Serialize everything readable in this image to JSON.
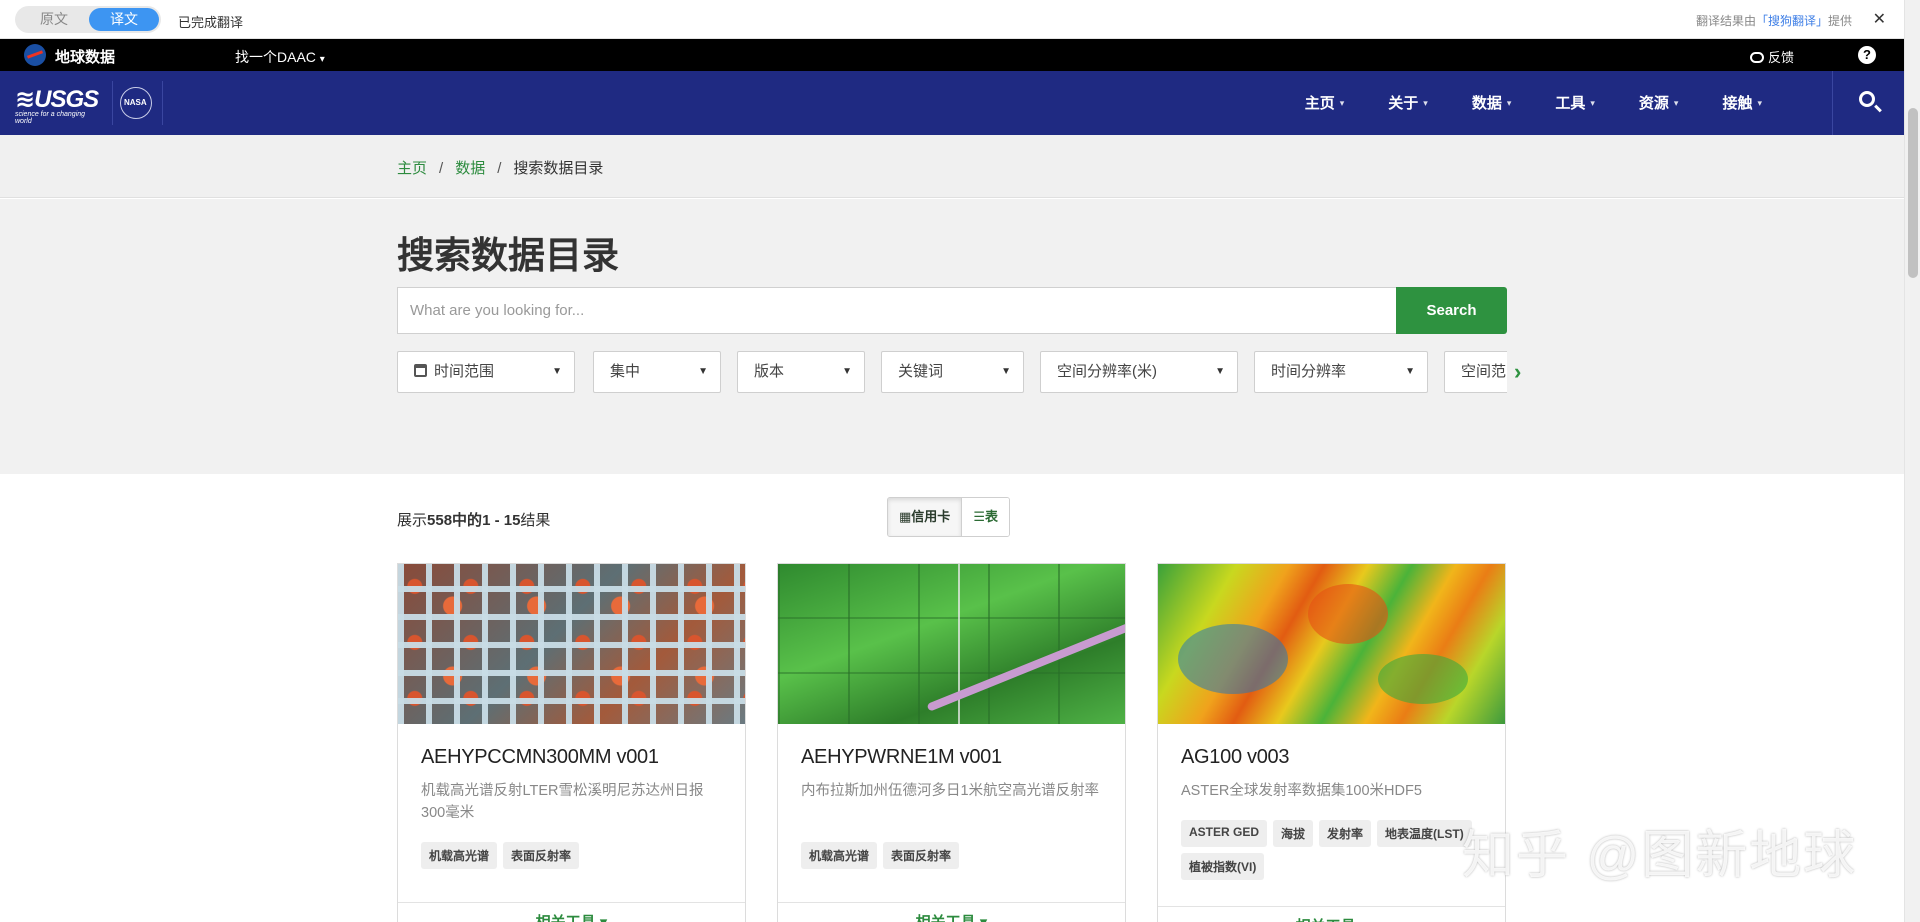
{
  "translate_bar": {
    "original_label": "原文",
    "translated_label": "译文",
    "status": "已完成翻译",
    "provider_prefix": "翻译结果由",
    "provider_link": "「搜狗翻译」",
    "provider_suffix": "提供",
    "close": "✕"
  },
  "topbar": {
    "site_title": "地球数据",
    "daac_label": "找一个DAAC",
    "daac_caret": "▾",
    "feedback": "反馈",
    "help": "?"
  },
  "nav": {
    "usgs_text": "≋USGS",
    "usgs_tagline": "science for a changing world",
    "nasa_text": "NASA",
    "items": [
      {
        "label": "主页"
      },
      {
        "label": "关于"
      },
      {
        "label": "数据"
      },
      {
        "label": "工具"
      },
      {
        "label": "资源"
      },
      {
        "label": "接触"
      }
    ],
    "caret": "▾"
  },
  "breadcrumb": {
    "items": [
      "主页",
      "数据",
      "搜索数据目录"
    ],
    "separator": "/"
  },
  "search": {
    "title": "搜索数据目录",
    "placeholder": "What are you looking for...",
    "value": "",
    "button": "Search"
  },
  "filters": [
    {
      "label": "时间范围"
    },
    {
      "label": "集中"
    },
    {
      "label": "版本"
    },
    {
      "label": "关键词"
    },
    {
      "label": "空间分辨率(米)"
    },
    {
      "label": "时间分辨率"
    },
    {
      "label": "空间范围"
    }
  ],
  "filters_more": "›",
  "filters_caret": "▼",
  "results": {
    "prefix": "展示",
    "total": "558",
    "middle": "中的",
    "range": "1 - 15",
    "suffix": "结果",
    "view_cards": "信用卡",
    "view_table": "表",
    "cards_icon": "▦",
    "table_icon": "☰"
  },
  "cards": [
    {
      "title": "AEHYPCCMN300MM v001",
      "description": "机载高光谱反射LTER雪松溪明尼苏达州日报300毫米",
      "tags": [
        "机载高光谱",
        "表面反射率"
      ],
      "footer": "相关工具 ▾"
    },
    {
      "title": "AEHYPWRNE1M v001",
      "description": "内布拉斯加州伍德河多日1米航空高光谱反射率",
      "tags": [
        "机载高光谱",
        "表面反射率"
      ],
      "footer": "相关工具 ▾"
    },
    {
      "title": "AG100 v003",
      "description": "ASTER全球发射率数据集100米HDF5",
      "tags": [
        "ASTER GED",
        "海拔",
        "发射率",
        "地表温度(LST)",
        "植被指数(VI)"
      ],
      "footer": "相关工具 ▾"
    }
  ],
  "watermark": "知乎 @图新地球",
  "colors": {
    "nav_blue": "#1f2a82",
    "accent_green": "#2e9240",
    "toggle_blue": "#3d95f2"
  }
}
